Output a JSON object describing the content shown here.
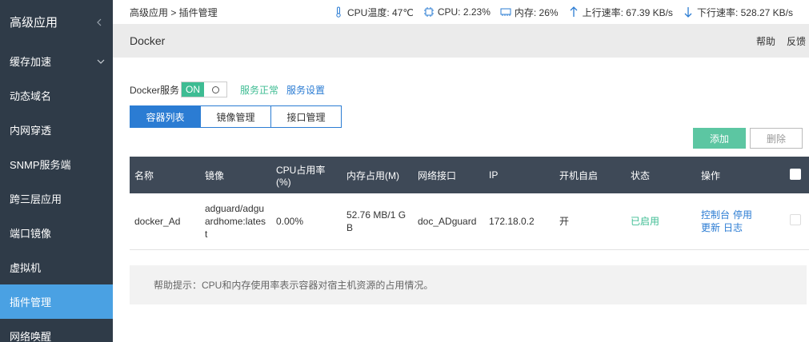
{
  "sidebar": {
    "header": "高级应用",
    "items": [
      {
        "label": "缓存加速",
        "expandable": true,
        "active": false
      },
      {
        "label": "动态域名",
        "active": false
      },
      {
        "label": "内网穿透",
        "active": false
      },
      {
        "label": "SNMP服务端",
        "active": false
      },
      {
        "label": "跨三层应用",
        "active": false
      },
      {
        "label": "端口镜像",
        "active": false
      },
      {
        "label": "虚拟机",
        "active": false
      },
      {
        "label": "插件管理",
        "active": true
      },
      {
        "label": "网络唤醒",
        "active": false
      }
    ]
  },
  "topbar": {
    "breadcrumb": "高级应用 > 插件管理",
    "cpu_temp": "CPU温度: 47℃",
    "cpu": "CPU: 2.23%",
    "memory": "内存: 26%",
    "upload": "上行速率: 67.39 KB/s",
    "download": "下行速率: 528.27 KB/s"
  },
  "titlebar": {
    "title": "Docker",
    "help": "帮助",
    "feedback": "反馈"
  },
  "service": {
    "label": "Docker服务",
    "toggle_on": "ON",
    "status": "服务正常",
    "settings": "服务设置"
  },
  "tabs": [
    {
      "label": "容器列表",
      "active": true
    },
    {
      "label": "镜像管理",
      "active": false
    },
    {
      "label": "接口管理",
      "active": false
    }
  ],
  "actions": {
    "add": "添加",
    "delete": "删除"
  },
  "table": {
    "headers": [
      "名称",
      "镜像",
      "CPU占用率(%)",
      "内存占用(M)",
      "网络接口",
      "IP",
      "开机自启",
      "状态",
      "操作"
    ],
    "rows": [
      {
        "name": "docker_Ad",
        "image": "adguard/adguardhome:latest",
        "cpu": "0.00%",
        "memory": "52.76 MB/1 GB",
        "interface": "doc_ADguard",
        "ip": "172.18.0.2",
        "autostart": "开",
        "status": "已启用",
        "ops": [
          "控制台",
          "停用",
          "更新",
          "日志"
        ]
      }
    ]
  },
  "help": "帮助提示：CPU和内存使用率表示容器对宿主机资源的占用情况。",
  "colors": {
    "sidebar_bg": "#2f3b48",
    "sidebar_active": "#4aa1e3",
    "accent_blue": "#2b7cd3",
    "accent_green": "#3ebc93",
    "table_header": "#3e4957"
  }
}
